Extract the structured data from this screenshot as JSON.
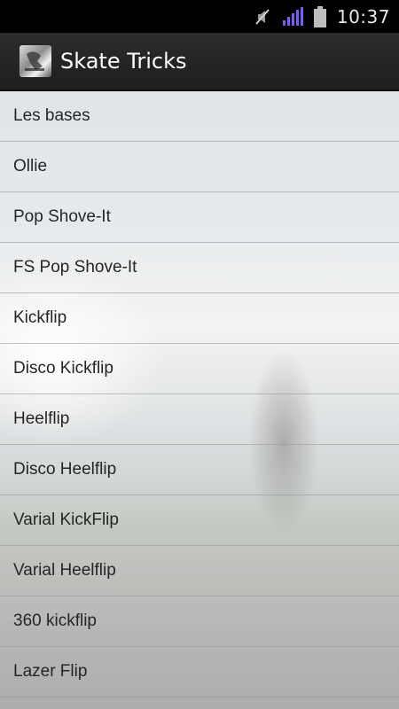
{
  "status_bar": {
    "time": "10:37",
    "icons": [
      "mute-icon",
      "signal-icon",
      "battery-icon"
    ]
  },
  "action_bar": {
    "title": "Skate Tricks",
    "icon": "app-logo-icon"
  },
  "tricks": [
    {
      "label": "Les bases"
    },
    {
      "label": "Ollie"
    },
    {
      "label": "Pop Shove-It"
    },
    {
      "label": "FS Pop Shove-It"
    },
    {
      "label": "Kickflip"
    },
    {
      "label": "Disco Kickflip"
    },
    {
      "label": "Heelflip"
    },
    {
      "label": "Disco Heelflip"
    },
    {
      "label": "Varial KickFlip"
    },
    {
      "label": "Varial Heelflip"
    },
    {
      "label": "360 kickflip"
    },
    {
      "label": "Lazer Flip"
    }
  ],
  "colors": {
    "status_bar_bg": "#000000",
    "action_bar_bg": "#242424",
    "signal_accent": "#7a5cf0",
    "list_text": "#262626"
  }
}
